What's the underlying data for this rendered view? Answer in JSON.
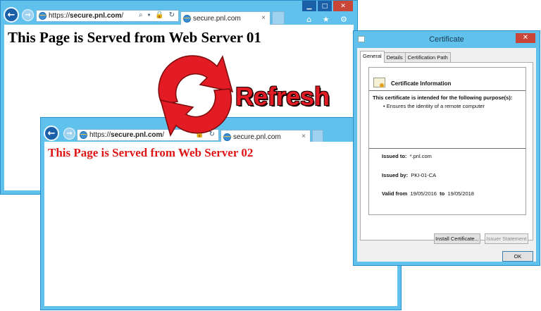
{
  "browser1": {
    "url_prefix": "https://",
    "url_host": "secure.pnl.com",
    "url_suffix": "/",
    "addr_tools": "⌕ ▾ 🔒 ↻",
    "tab_title": "secure.pnl.com",
    "tab_close": "×",
    "heading": "This Page is Served from Web Server 01",
    "min": "▁",
    "max": "□",
    "close": "✕",
    "toolbar_icons": "⌂ ★ ⚙"
  },
  "browser2": {
    "url_prefix": "https://",
    "url_host": "secure.pnl.com",
    "url_suffix": "/",
    "addr_tools": "🔒 ↻",
    "tab_title": "secure.pnl.com",
    "tab_close": "×",
    "heading": "This Page is Served from Web Server 02"
  },
  "refresh": {
    "label": "Refresh",
    "color": "#e21b24"
  },
  "certificate": {
    "title": "Certificate",
    "close": "✕",
    "tabs": [
      "General",
      "Details",
      "Certification Path"
    ],
    "info_title": "Certificate Information",
    "purpose_heading": "This certificate is intended for the following purpose(s):",
    "purposes": [
      "• Ensures the identity of a remote computer"
    ],
    "issued_to_label": "Issued to:",
    "issued_to_value": "*.pnl.com",
    "issued_by_label": "Issued by:",
    "issued_by_value": "PKI-01-CA",
    "valid_from_label": "Valid from",
    "valid_from_value": "19/05/2016",
    "valid_to_label": "to",
    "valid_to_value": "19/05/2018",
    "install_button": "Install Certificate...",
    "issuer_button": "Issuer Statement",
    "ok_button": "OK"
  },
  "colors": {
    "window_frame": "#5fc1ec",
    "heading2": "#e01515",
    "close_red": "#c94538"
  }
}
